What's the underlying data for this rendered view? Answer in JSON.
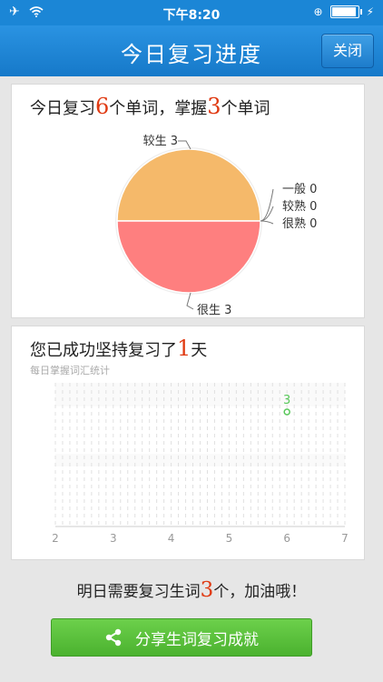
{
  "status_bar": {
    "time": "下午8:20"
  },
  "nav": {
    "title": "今日复习进度",
    "close_label": "关闭"
  },
  "review_summary": {
    "prefix": "今日复习",
    "reviewed_count": "6",
    "mid": "个单词，掌握",
    "mastered_count": "3",
    "suffix": "个单词"
  },
  "streak": {
    "prefix": "您已成功坚持复习了",
    "days": "1",
    "suffix": "天"
  },
  "footer": {
    "prefix": "明日需要复习生词",
    "count": "3",
    "suffix": "个，加油哦！",
    "share_label": "分享生词复习成就"
  },
  "colors": {
    "accent": "#1b86d6",
    "pie_orange": "#f5b96a",
    "pie_red": "#fe7f7f",
    "line_green": "#58c85a",
    "highlight": "#e03a12",
    "share_green": "#55bb37"
  },
  "chart_data": [
    {
      "type": "pie",
      "slices": [
        {
          "label": "较生",
          "value": 3,
          "display": "较生 3"
        },
        {
          "label": "很生",
          "value": 3,
          "display": "很生 3"
        },
        {
          "label": "一般",
          "value": 0,
          "display": "一般 0"
        },
        {
          "label": "较熟",
          "value": 0,
          "display": "较熟 0"
        },
        {
          "label": "很熟",
          "value": 0,
          "display": "很熟 0"
        }
      ]
    },
    {
      "type": "line",
      "title": "每日掌握词汇统计",
      "x_ticks": [
        "2",
        "3",
        "4",
        "5",
        "6",
        "7"
      ],
      "xlim": [
        2,
        7
      ],
      "points": [
        {
          "x": 6,
          "y": 3,
          "label": "3"
        }
      ],
      "grid": true
    }
  ]
}
